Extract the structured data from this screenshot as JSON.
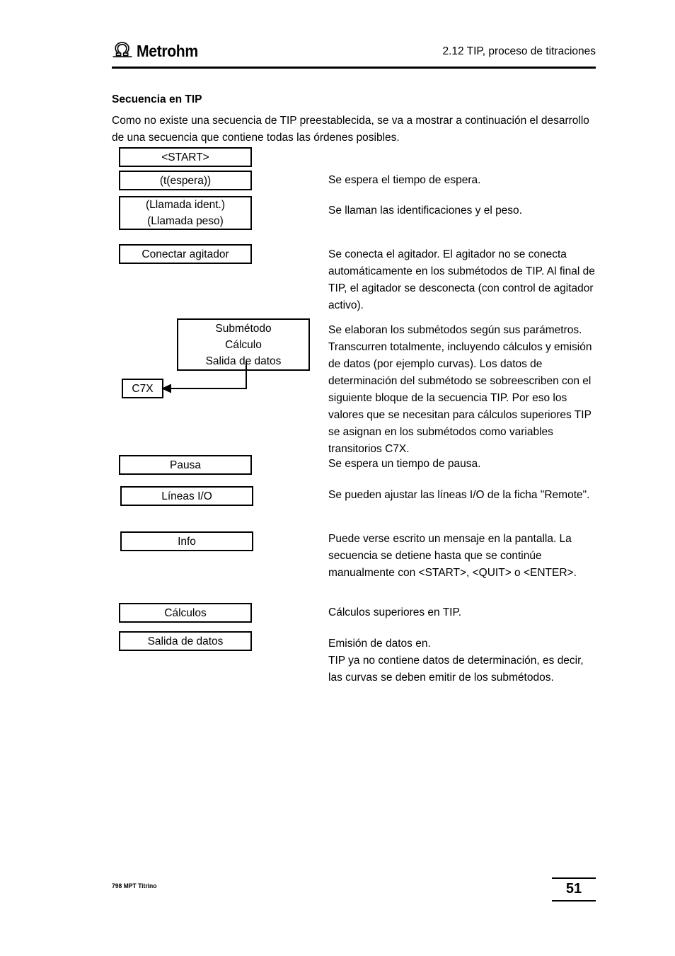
{
  "header": {
    "logo_text": "Metrohm",
    "logo_icon": "metrohm-omega-mark",
    "title": "2.12 TIP, proceso de titraciones"
  },
  "content": {
    "section_title": "Secuencia en TIP",
    "intro": "Como no existe una secuencia de TIP preestablecida, se va a mostrar a continuación el desarrollo de una secuencia que contiene todas las órdenes posibles."
  },
  "flow": {
    "boxes": [
      {
        "id": "start",
        "lines": [
          "<START>"
        ]
      },
      {
        "id": "wait-time",
        "lines": [
          "(t(espera))"
        ]
      },
      {
        "id": "calls",
        "lines": [
          "(Llamada ident.)",
          "(Llamada peso)"
        ]
      },
      {
        "id": "stirrer",
        "lines": [
          "Conectar agitador"
        ]
      },
      {
        "id": "submethod",
        "lines": [
          "Submétodo",
          "Cálculo",
          "Salida de datos"
        ]
      },
      {
        "id": "c7x",
        "lines": [
          "C7X"
        ]
      },
      {
        "id": "pause",
        "lines": [
          "Pausa"
        ]
      },
      {
        "id": "io-lines",
        "lines": [
          "Líneas I/O"
        ]
      },
      {
        "id": "info",
        "lines": [
          "Info"
        ]
      },
      {
        "id": "calculations",
        "lines": [
          "Cálculos"
        ]
      },
      {
        "id": "data-output",
        "lines": [
          "Salida de datos"
        ]
      }
    ]
  },
  "notes": {
    "wait_time": "Se espera el tiempo de espera.",
    "calls": "Se llaman las identificaciones y el peso.",
    "stirrer": "Se conecta el agitador. El agitador no se conecta automáticamente en los submétodos de TIP. Al final de TIP, el agitador se desconecta (con control de agitador activo).",
    "submethod": "Se elaboran los submétodos según sus parámetros. Transcurren totalmente, incluyendo cálculos y emisión de datos (por ejemplo curvas). Los datos de determinación del submétodo se sobreescriben con el siguiente bloque de la secuencia TIP. Por eso los valores que se necesitan para cálculos superiores TIP se asignan en los submétodos como variables transitorios C7X.",
    "pause": "Se espera un tiempo de pausa.",
    "io_lines": "Se pueden ajustar las líneas I/O de la ficha \"Remote\".",
    "info": "Puede verse escrito un mensaje en la pantalla. La secuencia se detiene hasta que se continúe manualmente con <START>, <QUIT> o <ENTER>.",
    "calculations": "Cálculos superiores en TIP.",
    "data_output": "Emisión de datos en.\nTIP ya no contiene datos de determinación, es decir, las curvas se deben emitir de los submétodos."
  },
  "footer": {
    "product": "798 MPT Titrino",
    "page_number": "51"
  },
  "colors": {
    "ink": "#000000",
    "paper": "#ffffff"
  }
}
